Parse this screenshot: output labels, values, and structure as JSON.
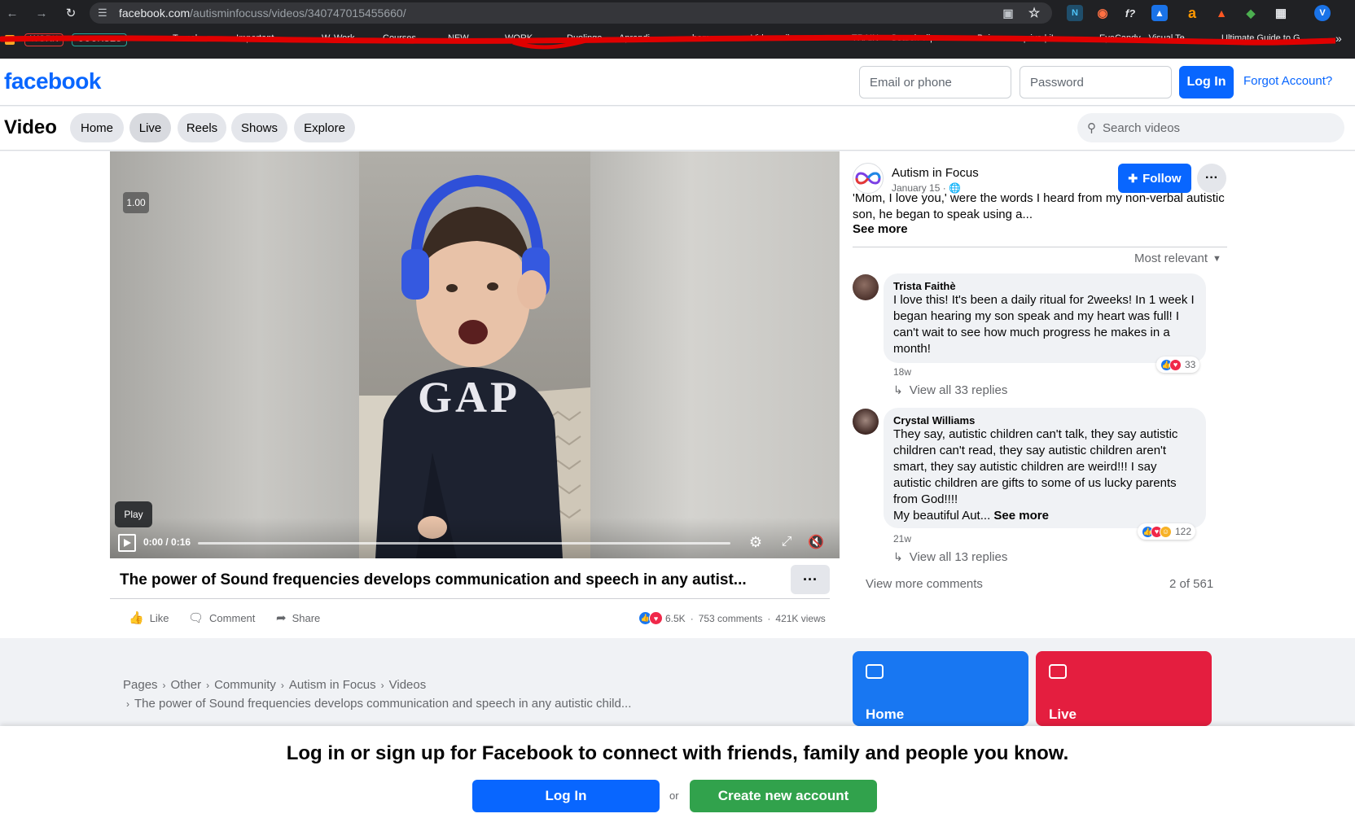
{
  "browser": {
    "url_domain": "facebook.com",
    "url_path": "/autisminfocuss/videos/340747015455660/",
    "bookmarks": [
      "WORK",
      "COURSES",
      "Transl…",
      "Important",
      "W…",
      "Work",
      "Courses",
      "NEW",
      "WORK",
      "Duolingo",
      "Aprendi…",
      "home",
      "Videoscribe",
      "TRAIN",
      "Search clips",
      "Baixar o arquivo | iL…",
      "EyeCandy - Visual Te…",
      "Ultimate Guide to G…"
    ],
    "profile_initial": "V"
  },
  "header": {
    "logo": "facebook",
    "email_placeholder": "Email or phone",
    "password_placeholder": "Password",
    "login_label": "Log In",
    "forgot_label": "Forgot Account?"
  },
  "video_nav": {
    "title": "Video",
    "tabs": [
      "Home",
      "Live",
      "Reels",
      "Shows",
      "Explore"
    ],
    "active_tab": "Live",
    "search_placeholder": "Search videos"
  },
  "player": {
    "speed": "1.00",
    "tooltip": "Play",
    "time": "0:00 / 0:16",
    "progress_fraction": 0,
    "shirt_text": "GAP"
  },
  "video": {
    "title": "The power of Sound frequencies develops communication and speech in any autist...",
    "more": "···",
    "actions": [
      "Like",
      "Comment",
      "Share"
    ],
    "reactions_count": "6.5K",
    "comments_count": "753 comments",
    "views": "421K views",
    "dot": "·"
  },
  "post": {
    "page_name": "Autism in Focus",
    "date": "January 15 · ",
    "description": "'Mom, I love you,' were the words I heard from my non-verbal autistic son, he began to speak using a...",
    "see_more": "See more",
    "follow_label": "Follow",
    "more": "···"
  },
  "comments": {
    "sort_label": "Most relevant",
    "items": [
      {
        "author": "Trista Faithè",
        "text": "I love this! It's been a daily ritual for 2weeks! In 1 week I began hearing my son speak and my heart was full! I can't wait to see how much progress he makes in a month!",
        "age": "18w",
        "reactions": "33",
        "replies": "View all 33 replies"
      },
      {
        "author": "Crystal Williams",
        "text": "They say, autistic children can't talk, they say autistic children can't read, they say autistic children aren't smart, they say autistic children are weird!!! I say autistic children are gifts to some of us lucky parents from God!!!!",
        "text2": "My beautiful Aut...",
        "see_more": "See more",
        "age": "21w",
        "reactions": "122",
        "replies": "View all 13 replies"
      }
    ],
    "view_more": "View more comments",
    "pager": "2 of 561"
  },
  "breadcrumbs": {
    "items": [
      "Pages",
      "Other",
      "Community",
      "Autism in Focus",
      "Videos"
    ],
    "current": "The power of Sound frequencies develops communication and speech in any autistic child..."
  },
  "tiles": [
    {
      "label": "Home",
      "color": "#1877f2"
    },
    {
      "label": "Live",
      "color": "#e41e3f"
    }
  ],
  "banner": {
    "text": "Log in or sign up for Facebook to connect with friends, family and people you know.",
    "login_label": "Log In",
    "or": "or",
    "create_label": "Create new account"
  },
  "colors": {
    "fb_blue": "#0866ff",
    "green": "#31a24c",
    "red": "#e41e3f"
  }
}
